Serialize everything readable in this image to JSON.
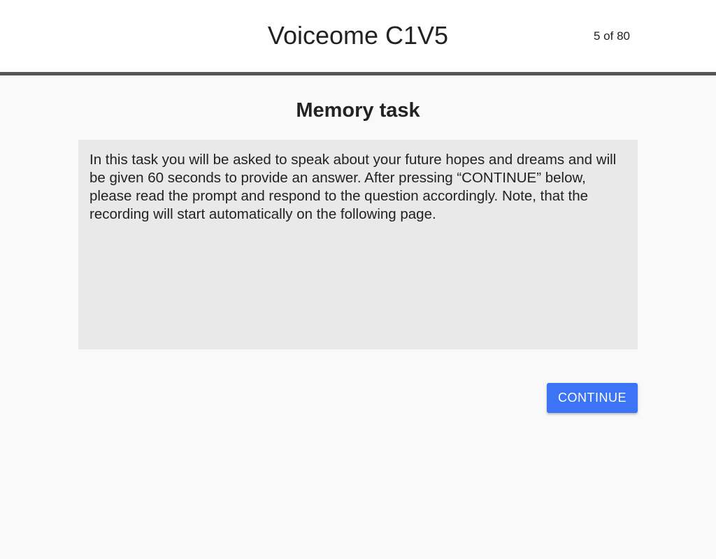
{
  "header": {
    "title": "Voiceome C1V5",
    "page_counter": "5 of 80"
  },
  "task": {
    "title": "Memory task",
    "instructions": "In this task you will be asked to speak about your future hopes and dreams and will be given 60 seconds to provide an answer. After pressing “CONTINUE” below, please read the prompt and respond to the question accordingly. Note, that the recording will start automatically on the following page."
  },
  "actions": {
    "continue_label": "CONTINUE"
  },
  "colors": {
    "header_background": "#ffffff",
    "header_border": "#555555",
    "page_background": "#f9f9f9",
    "instruction_background": "#e9e9e9",
    "button_background": "#3d73f5",
    "button_text": "#ffffff"
  }
}
